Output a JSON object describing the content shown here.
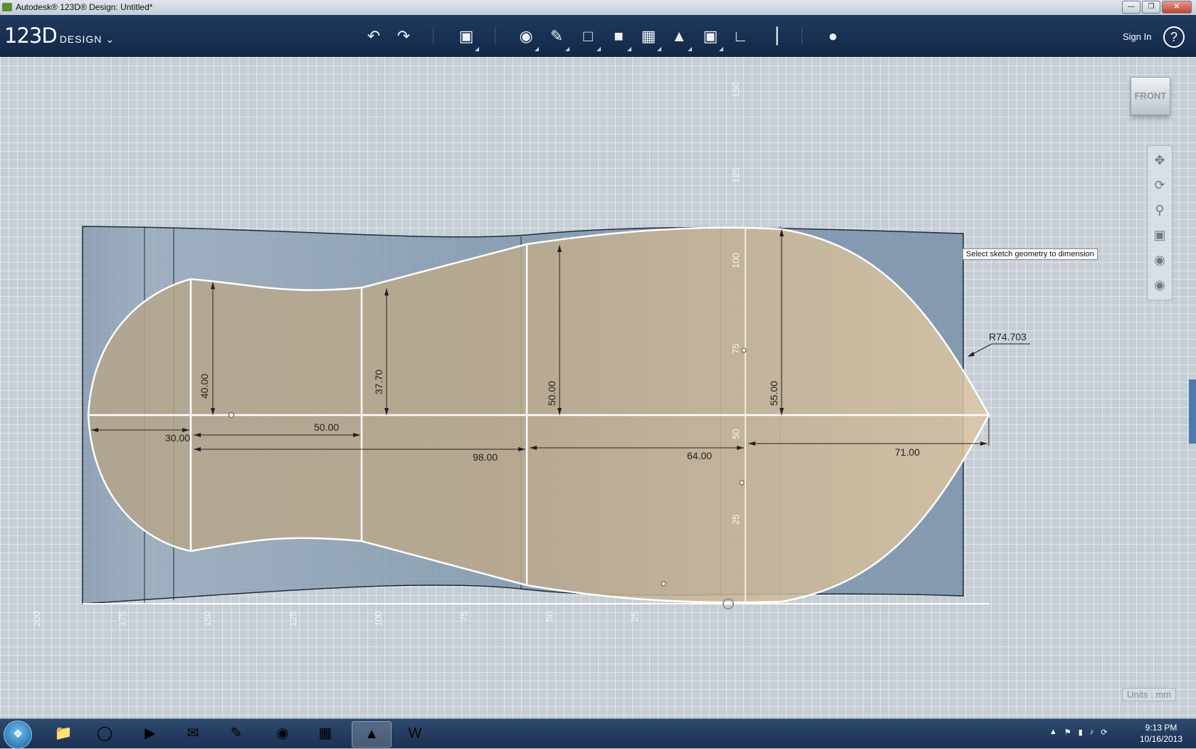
{
  "window": {
    "title": "Autodesk® 123D® Design: Untitled*"
  },
  "toolbar": {
    "brand": "123D",
    "product": "DESIGN",
    "sign_in": "Sign In",
    "help": "?",
    "icons": [
      "undo-icon",
      "redo-icon",
      "transform-icon",
      "primitives-icon",
      "sketch-icon",
      "construct-icon",
      "modify-icon",
      "pattern-icon",
      "grouping-icon",
      "combine-icon",
      "snap-icon",
      "measure-icon",
      "material-icon"
    ]
  },
  "viewport": {
    "viewcube_label": "FRONT",
    "hint": "Select sketch geometry to dimension",
    "units": "Units : mm",
    "ruler_horizontal": [
      "200",
      "175",
      "150",
      "125",
      "100",
      "75",
      "50",
      "25"
    ],
    "ruler_vertical": [
      "150",
      "125",
      "100",
      "75",
      "50",
      "25"
    ],
    "dimensions": {
      "d40": "40.00",
      "d37": "37.70",
      "d50v": "50.00",
      "d55": "55.00",
      "d30": "30.00",
      "d50h": "50.00",
      "d98": "98.00",
      "d64": "64.00",
      "d71": "71.00",
      "radius": "R74.703"
    },
    "nav_tools": [
      "pan-icon",
      "orbit-icon",
      "zoom-icon",
      "fit-icon",
      "view-mode-icon",
      "visibility-icon"
    ]
  },
  "taskbar": {
    "apps": [
      "explorer-icon",
      "internet-explorer-icon",
      "media-player-icon",
      "outlook-icon",
      "ribbon-app-icon",
      "chrome-icon",
      "control-panel-icon",
      "123d-design-icon",
      "word-icon"
    ],
    "time": "9:13 PM",
    "date": "10/16/2013"
  }
}
